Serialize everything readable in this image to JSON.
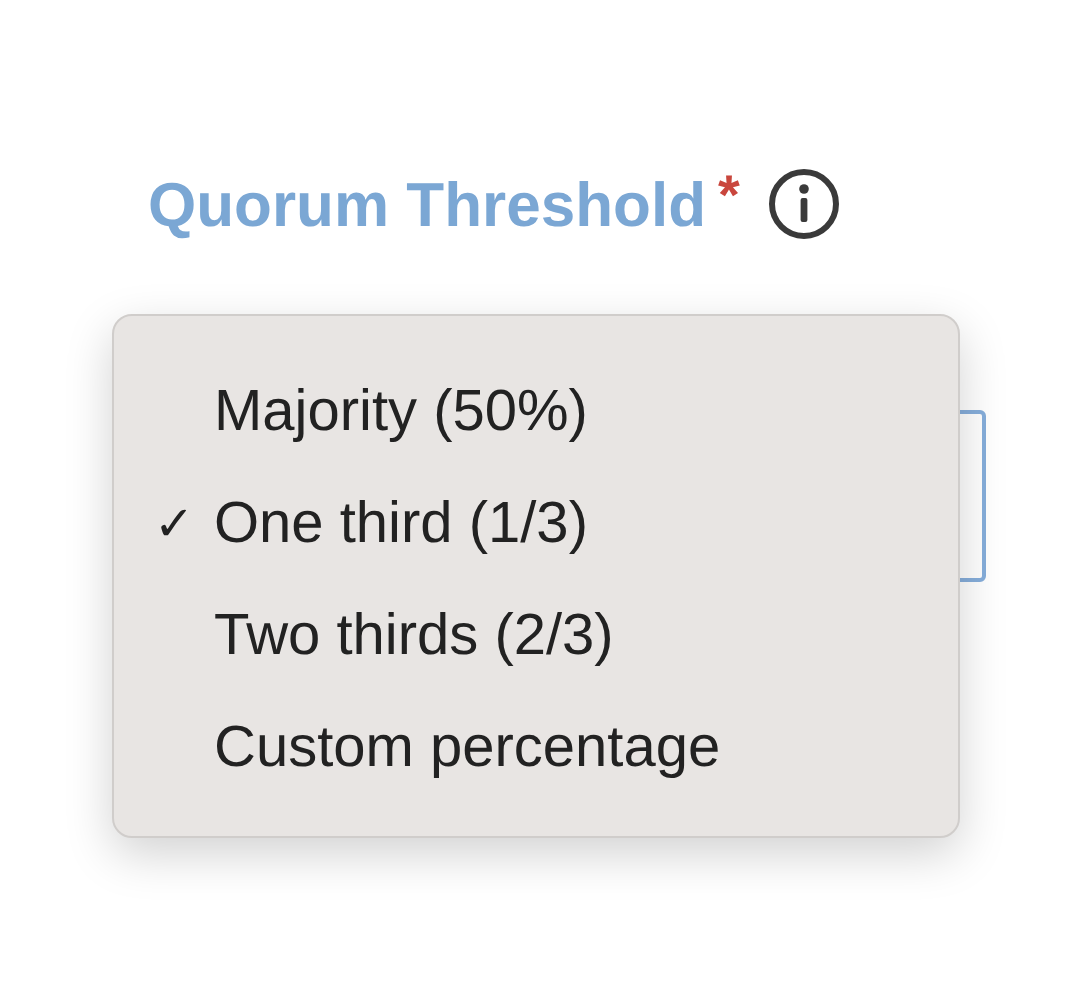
{
  "field": {
    "label": "Quorum Threshold",
    "required_mark": "*"
  },
  "menu": {
    "check_mark": "✓",
    "options": [
      {
        "label": "Majority (50%)",
        "selected": false
      },
      {
        "label": "One third (1/3)",
        "selected": true
      },
      {
        "label": "Two thirds (2/3)",
        "selected": false
      },
      {
        "label": "Custom percentage",
        "selected": false
      }
    ]
  }
}
